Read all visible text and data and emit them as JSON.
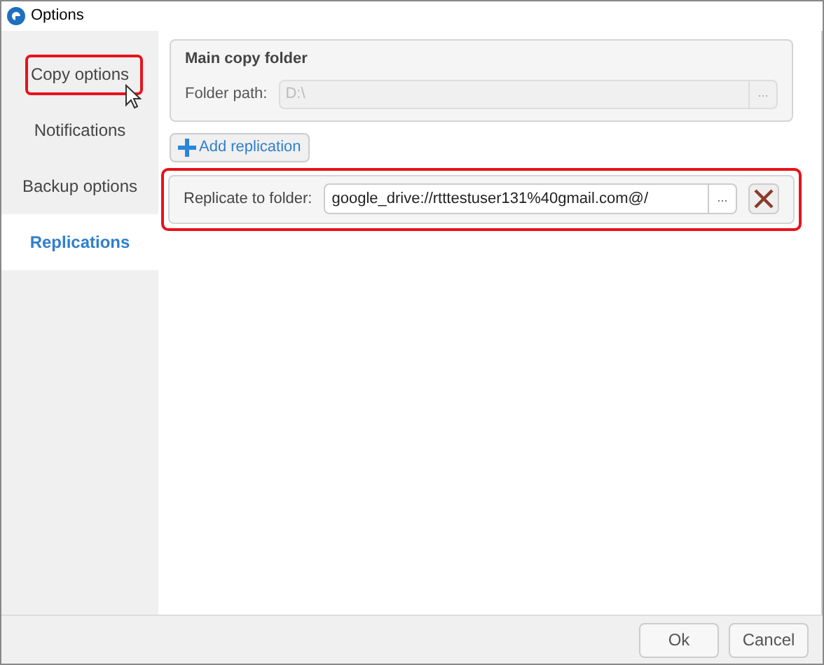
{
  "window": {
    "title": "Options"
  },
  "sidebar": {
    "items": [
      {
        "label": "Copy options",
        "selected": false,
        "highlighted": true
      },
      {
        "label": "Notifications",
        "selected": false,
        "highlighted": false
      },
      {
        "label": "Backup options",
        "selected": false,
        "highlighted": false
      },
      {
        "label": "Replications",
        "selected": true,
        "highlighted": false
      }
    ]
  },
  "main_copy_folder": {
    "title": "Main copy folder",
    "label": "Folder path:",
    "value": "D:\\",
    "disabled": true,
    "browse": "..."
  },
  "add_button": {
    "label": "Add replication"
  },
  "replications": [
    {
      "label": "Replicate to folder:",
      "value": "google_drive://rtttestuser131%40gmail.com@/",
      "browse": "...",
      "highlighted": true
    }
  ],
  "buttons": [
    {
      "label": "Ok"
    },
    {
      "label": "Cancel"
    }
  ]
}
